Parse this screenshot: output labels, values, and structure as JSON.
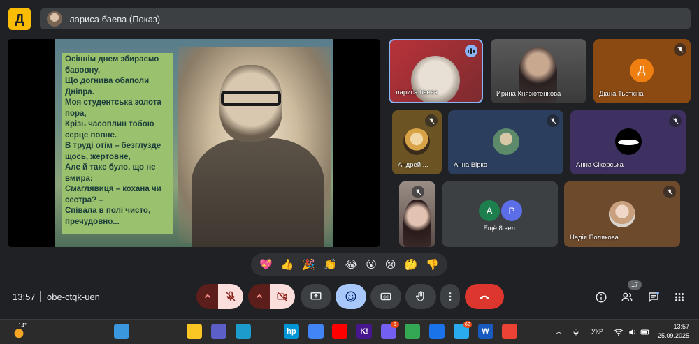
{
  "top_bar": {
    "logo_glyph": "Д",
    "presenter_label": "лариса баева (Показ)"
  },
  "slide": {
    "poem": "Осіннім днем збираємо\nбавовну,\nЩо догнива обаполи\nДніпра.\nМоя студентська золота\nпора,\nКрізь часоплин тобою\nсерце повне.\nВ труді отім – безглузде\nщось, жертовне,\nАле й таке було, що не\nвмира:\nСмаглявиця – кохана чи\nсестра? –\nСпівала в полі чисто,\nпречудовно..."
  },
  "participants": [
    {
      "name": "лариса баева",
      "state": "speaking"
    },
    {
      "name": "Ирина Князютенкова",
      "state": "camera"
    },
    {
      "name": "Діана Тьоткіна",
      "initial": "Д",
      "state": "muted"
    },
    {
      "name": "Андрей ...",
      "state": "muted"
    },
    {
      "name": "Анна Вірко",
      "state": "muted"
    },
    {
      "name": "Анна Сікорська",
      "state": "muted"
    },
    {
      "name": "",
      "state": "muted"
    },
    {
      "name": "Надія Полякова",
      "state": "muted"
    }
  ],
  "more_tile": {
    "label": "Ещё 8 чел.",
    "initials": [
      "А",
      "Р"
    ]
  },
  "reactions": [
    "💖",
    "👍",
    "🎉",
    "👏",
    "😂",
    "😮",
    "😢",
    "🤔",
    "👎"
  ],
  "footer": {
    "time": "13:57",
    "meeting_code": "obe-ctqk-uen",
    "participants_count": "17"
  },
  "taskbar": {
    "weather_temp": "14°",
    "language": "УКР",
    "clock_time": "13:57",
    "clock_date": "25.09.2025",
    "apps": [
      {
        "name": "windows-start",
        "color": "#3a96dd"
      },
      {
        "name": "search",
        "color": "#2b2b2b"
      },
      {
        "name": "task-view",
        "color": "#2b2b2b"
      },
      {
        "name": "file-explorer",
        "color": "#f9c623"
      },
      {
        "name": "teams",
        "color": "#5b5fc7"
      },
      {
        "name": "edge",
        "color": "#1c9ccd"
      },
      {
        "name": "store",
        "color": "#2b2b2b"
      },
      {
        "name": "hp",
        "color": "#0096d6",
        "glyph": "hp"
      },
      {
        "name": "chrome-check",
        "color": "#4285f4"
      },
      {
        "name": "youtube",
        "color": "#ff0000"
      },
      {
        "name": "kahoot",
        "color": "#46178f",
        "glyph": "K!"
      },
      {
        "name": "viber",
        "color": "#7360f2",
        "badge": "6"
      },
      {
        "name": "chrome",
        "color": "#34a853"
      },
      {
        "name": "globe",
        "color": "#1a73e8"
      },
      {
        "name": "telegram",
        "color": "#2aabee",
        "badge": "62"
      },
      {
        "name": "word",
        "color": "#185abd",
        "glyph": "W"
      },
      {
        "name": "chrome-profile",
        "color": "#ea4335"
      }
    ]
  }
}
